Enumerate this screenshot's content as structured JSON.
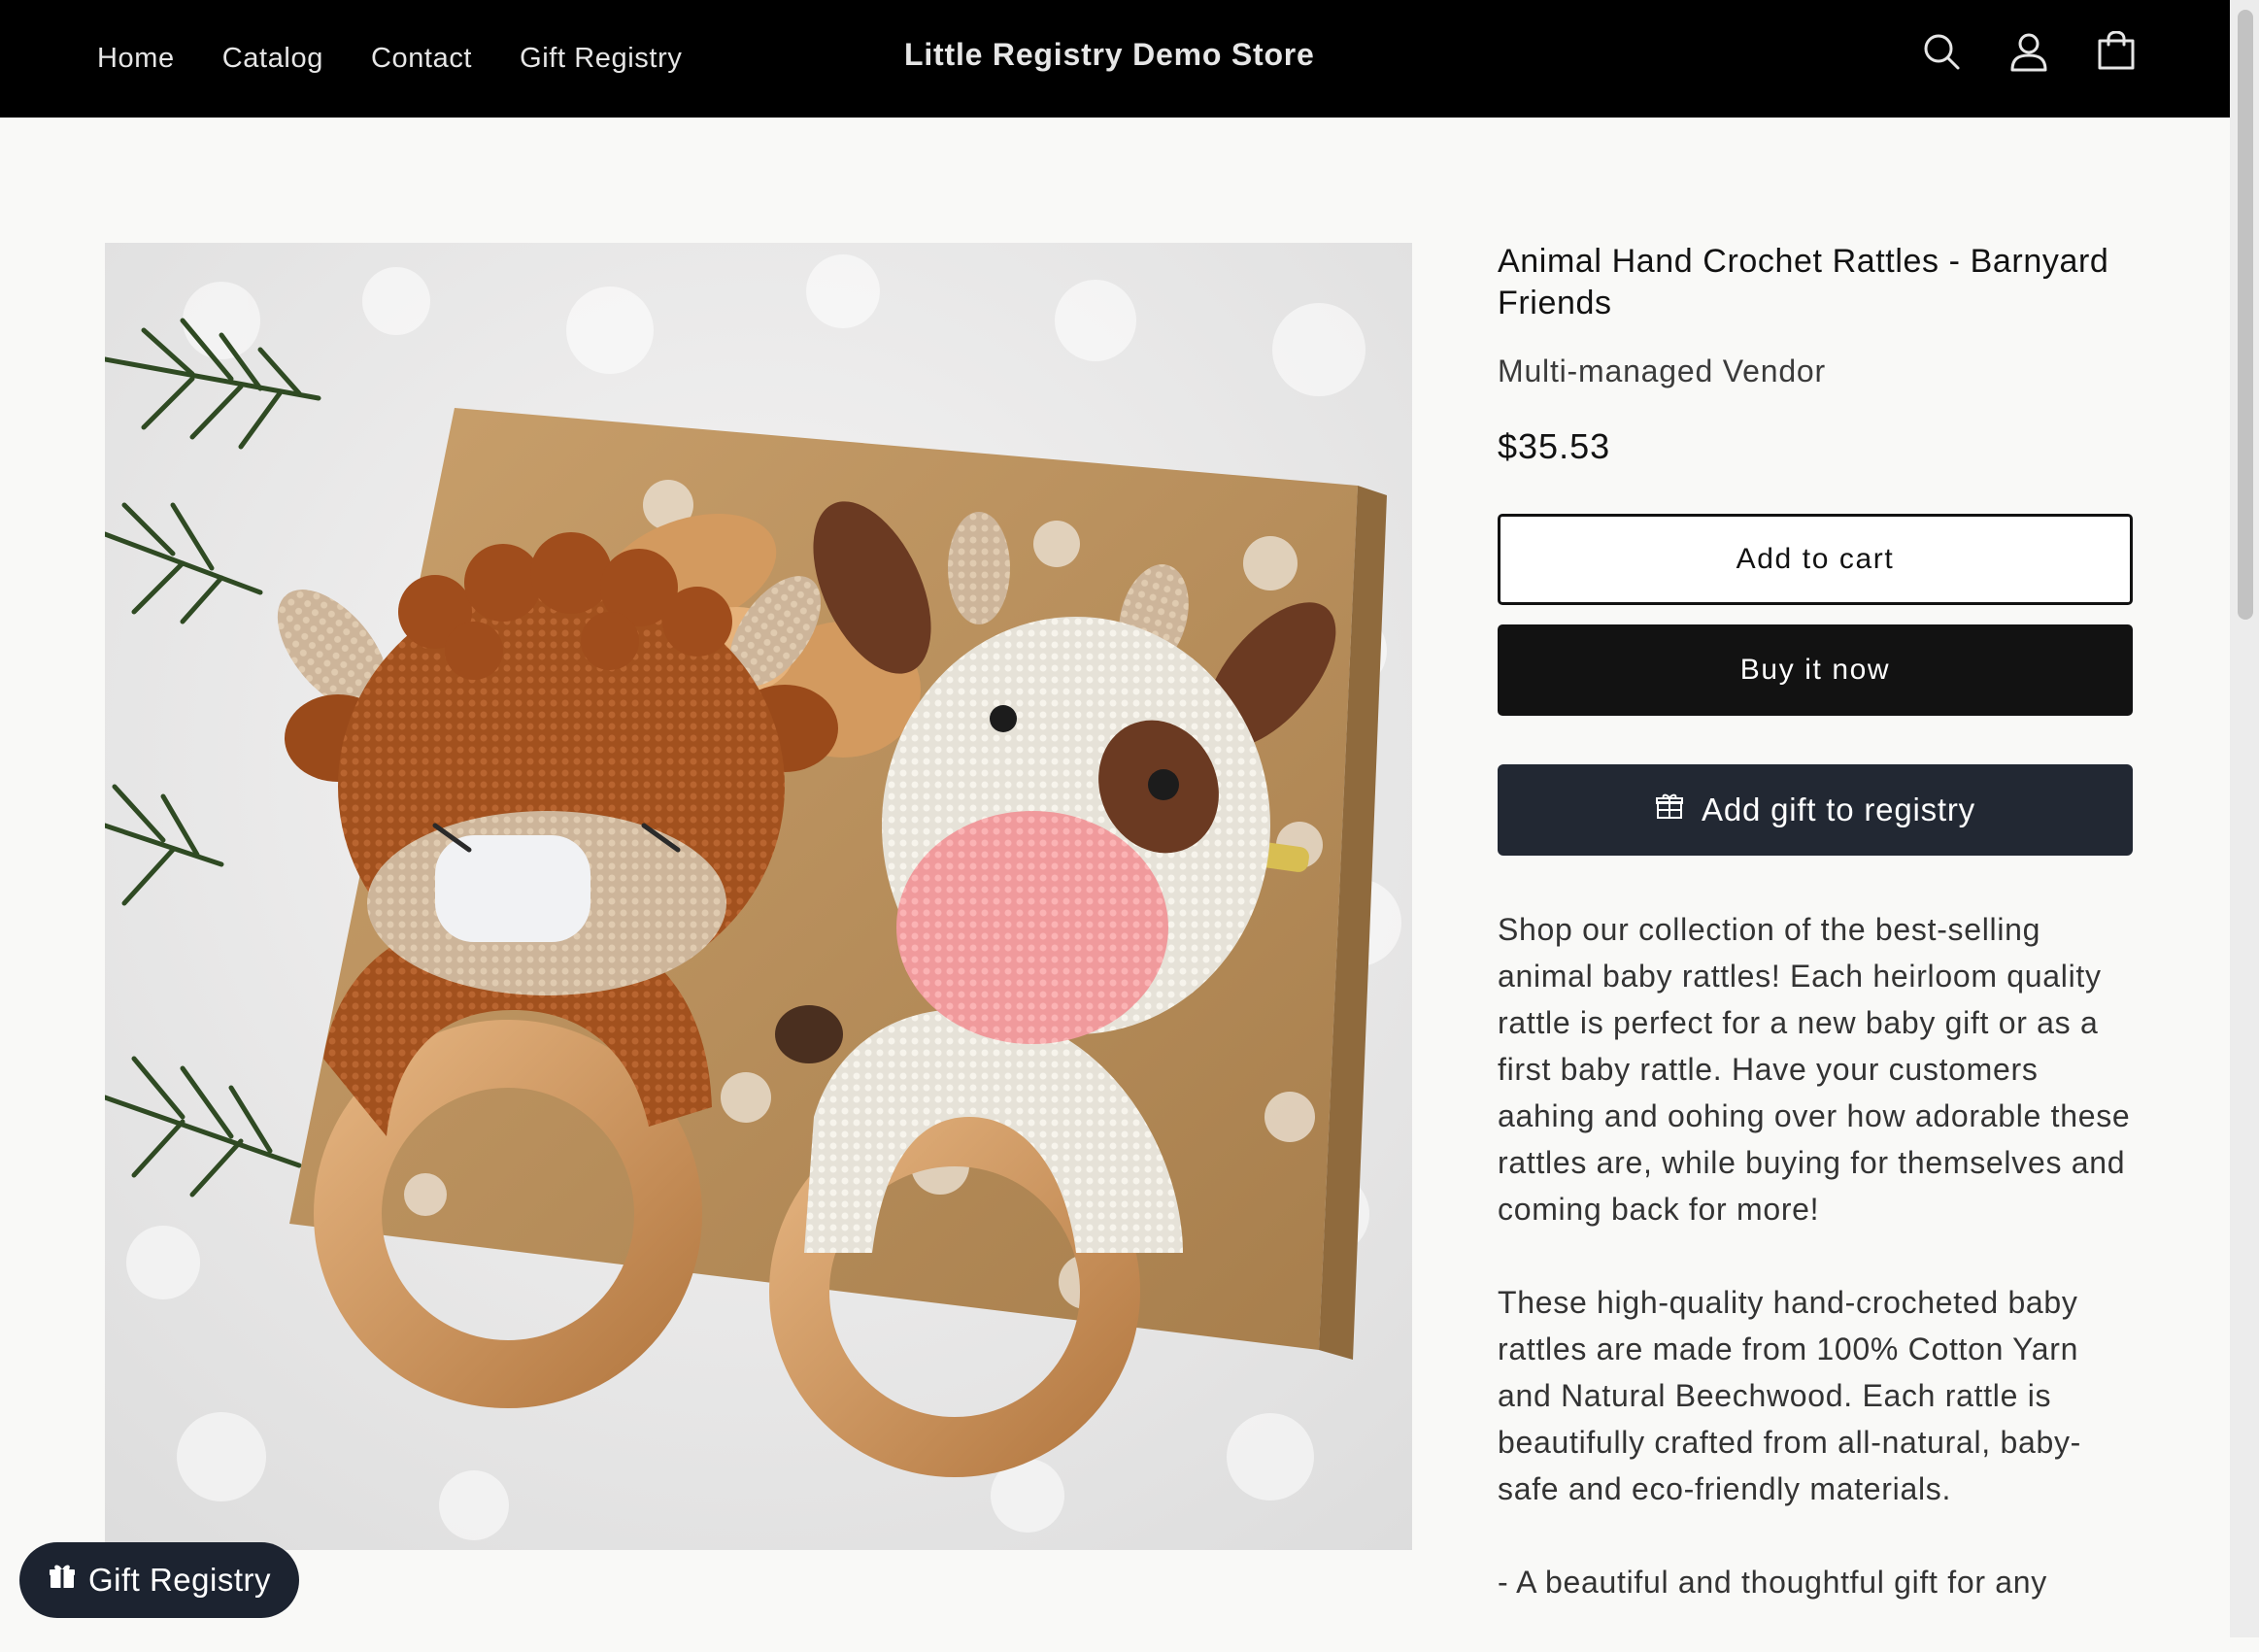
{
  "header": {
    "store_name": "Little Registry Demo Store",
    "nav": [
      "Home",
      "Catalog",
      "Contact",
      "Gift Registry"
    ],
    "icons": [
      "search-icon",
      "account-icon",
      "cart-icon"
    ],
    "background": "#000000"
  },
  "product": {
    "image_alt": "Animal Hand Crochet Rattles - Barnyard Friends",
    "title": "Animal Hand Crochet Rattles - Barnyard Friends",
    "vendor": "Multi-managed Vendor",
    "price": "$35.53",
    "add_to_cart_label": "Add to cart",
    "buy_now_label": "Buy it now",
    "registry_label": "Add gift to registry",
    "registry_icon": "gift-icon",
    "description": [
      "Shop our collection of the best-selling animal baby rattles! Each heirloom quality rattle is perfect for a new baby gift or as a first baby rattle. Have your customers aahing and oohing over how adorable these rattles are, while buying for themselves and coming back for more!",
      "These high-quality hand-crocheted baby rattles are made from 100% Cotton Yarn and Natural Beechwood. Each rattle is beautifully crafted from all-natural, baby-safe and eco-friendly materials.",
      "- A beautiful and thoughtful gift for any"
    ]
  },
  "floating_button": {
    "label": "Gift Registry",
    "icon": "gift-icon"
  },
  "colors": {
    "page_bg": "#f9f9f7",
    "registry_button": "#222833",
    "buy_button": "#121212"
  }
}
